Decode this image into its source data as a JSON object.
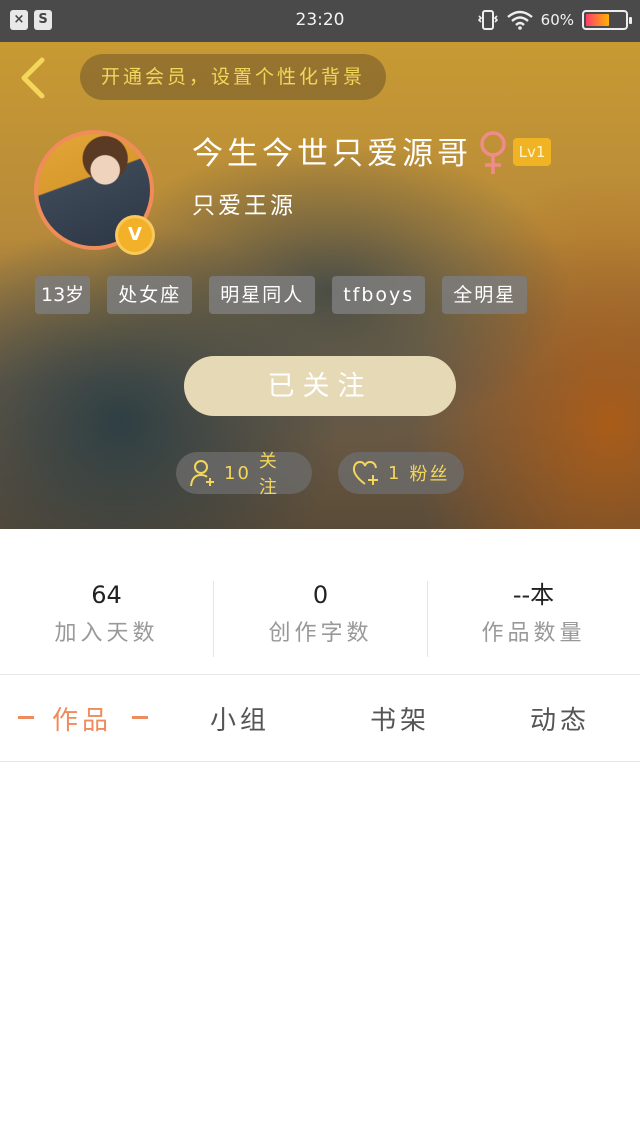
{
  "status_bar": {
    "time": "23:20",
    "battery": "60%",
    "battery_level": 0.6
  },
  "header": {
    "vip_banner": "开通会员，设置个性化背景",
    "username": "今生今世只爱源哥",
    "level": "Lv1",
    "bio": "只爱王源",
    "badge": "V",
    "tags": [
      "13岁",
      "处女座",
      "明星同人",
      "tfboys",
      "全明星"
    ],
    "follow_button": "已关注",
    "following": {
      "count": "10",
      "label": "关注"
    },
    "fans": {
      "count": "1",
      "label": "粉丝"
    },
    "colors": {
      "accent_yellow": "#f3d65a",
      "level_badge": "#f0b323",
      "avatar_ring": "#f08b5a",
      "gender": "#f08b8b"
    }
  },
  "stats": [
    {
      "value": "64",
      "label": "加入天数"
    },
    {
      "value": "0",
      "label": "创作字数"
    },
    {
      "value": "--本",
      "label": "作品数量"
    }
  ],
  "tabs": [
    {
      "label": "作品",
      "active": true
    },
    {
      "label": "小组",
      "active": false
    },
    {
      "label": "书架",
      "active": false
    },
    {
      "label": "动态",
      "active": false
    }
  ],
  "theme": {
    "active_tab": "#ef8c5e"
  }
}
